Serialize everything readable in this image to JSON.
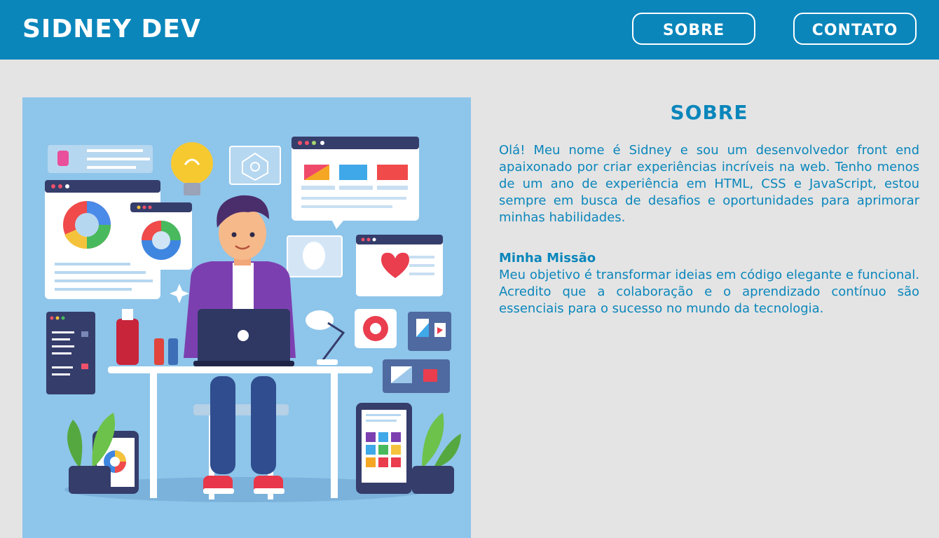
{
  "header": {
    "logo": "SIDNEY DEV",
    "nav": {
      "sobre_label": "SOBRE",
      "contato_label": "CONTATO"
    }
  },
  "hero_image": {
    "alt": "Ilustração de desenvolvedor trabalhando no laptop"
  },
  "about": {
    "title": "SOBRE",
    "text": "Olá! Meu nome é Sidney e sou um desenvolvedor front end apaixonado por criar experiências incríveis na web. Tenho menos de um ano de experiência em HTML, CSS e JavaScript, estou sempre em busca de desafios e oportunidades para aprimorar minhas habilidades.",
    "mission_title": "Minha Missão",
    "mission_text": "Meu objetivo é transformar ideias em código elegante e funcional. Acredito que a colaboração e o aprendizado contínuo são essenciais para o sucesso no mundo da tecnologia."
  },
  "colors": {
    "header_bg": "#0a86bb",
    "page_bg": "#e4e4e4",
    "accent": "#0a86bb",
    "hero_bg": "#8ec5ea"
  }
}
